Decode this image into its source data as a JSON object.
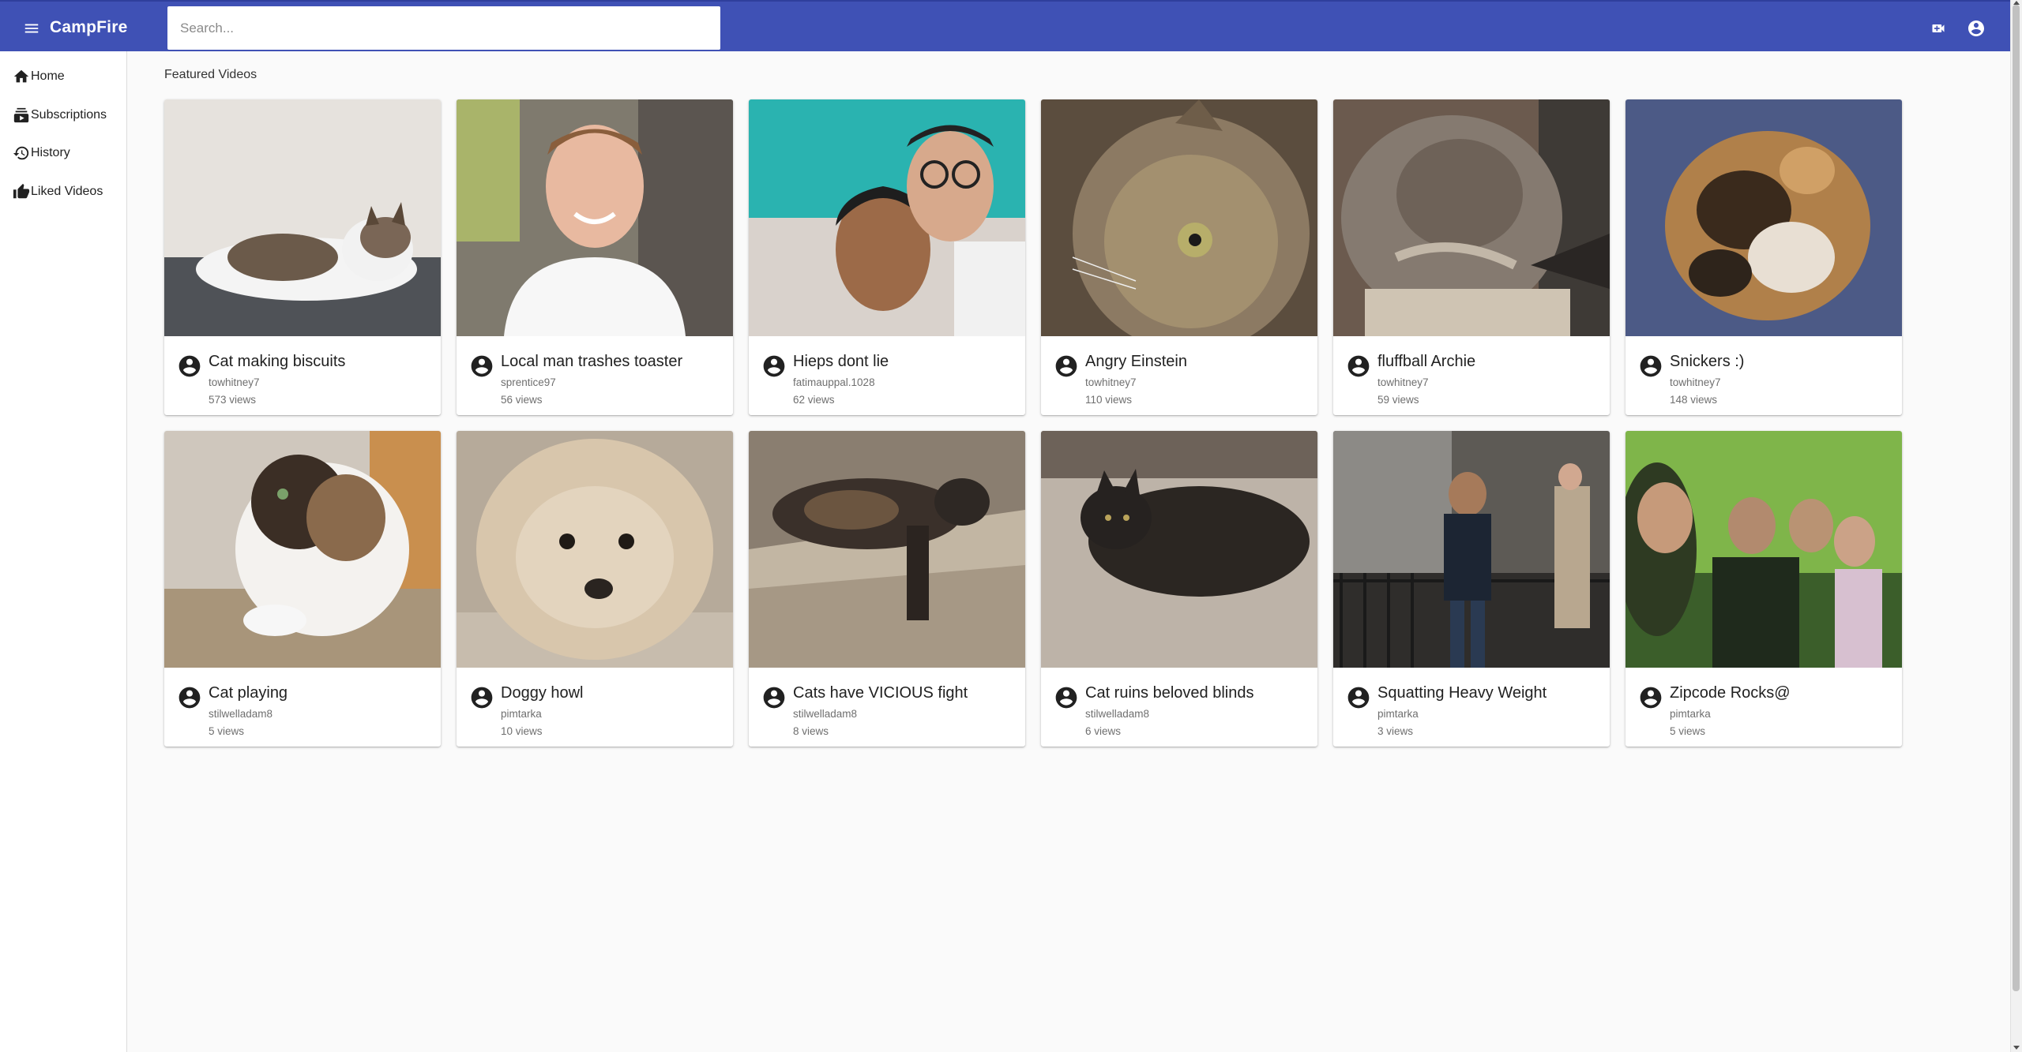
{
  "app": {
    "brand": "CampFire",
    "search_placeholder": "Search...",
    "primary_color": "#3f51b5"
  },
  "sidebar": {
    "items": [
      {
        "label": "Home",
        "icon": "home-icon"
      },
      {
        "label": "Subscriptions",
        "icon": "subscriptions-icon"
      },
      {
        "label": "History",
        "icon": "history-icon"
      },
      {
        "label": "Liked Videos",
        "icon": "thumb-up-icon"
      }
    ]
  },
  "main": {
    "section_title": "Featured Videos",
    "videos": [
      {
        "title": "Cat making biscuits",
        "channel": "towhitney7",
        "views": "573 views"
      },
      {
        "title": "Local man trashes toaster",
        "channel": "sprentice97",
        "views": "56 views"
      },
      {
        "title": "Hieps dont lie",
        "channel": "fatimauppal.1028",
        "views": "62 views"
      },
      {
        "title": "Angry Einstein",
        "channel": "towhitney7",
        "views": "110 views"
      },
      {
        "title": "fluffball Archie",
        "channel": "towhitney7",
        "views": "59 views"
      },
      {
        "title": "Snickers :)",
        "channel": "towhitney7",
        "views": "148 views"
      },
      {
        "title": "Cat playing",
        "channel": "stilwelladam8",
        "views": "5 views"
      },
      {
        "title": "Doggy howl",
        "channel": "pimtarka",
        "views": "10 views"
      },
      {
        "title": "Cats have VICIOUS fight",
        "channel": "stilwelladam8",
        "views": "8 views"
      },
      {
        "title": "Cat ruins beloved blinds",
        "channel": "stilwelladam8",
        "views": "6 views"
      },
      {
        "title": "Squatting Heavy Weight",
        "channel": "pimtarka",
        "views": "3 views"
      },
      {
        "title": "Zipcode Rocks@",
        "channel": "pimtarka",
        "views": "5 views"
      }
    ]
  }
}
